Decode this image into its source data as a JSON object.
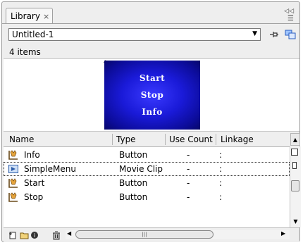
{
  "tab": {
    "label": "Library",
    "close": "×"
  },
  "panel_menu": {
    "collapse": "◁◁",
    "options": "☰"
  },
  "document_select": {
    "value": "Untitled-1"
  },
  "item_count": "4 items",
  "preview": {
    "buttons": [
      "Start",
      "Stop",
      "Info"
    ]
  },
  "columns": {
    "name": "Name",
    "type": "Type",
    "use_count": "Use Count",
    "linkage": "Linkage"
  },
  "items": [
    {
      "name": "Info",
      "type": "Button",
      "use_count": "-",
      "linkage": ":",
      "icon": "button-symbol-icon"
    },
    {
      "name": "SimpleMenu",
      "type": "Movie Clip",
      "use_count": "-",
      "linkage": ":",
      "icon": "movie-clip-symbol-icon",
      "selected": true
    },
    {
      "name": "Start",
      "type": "Button",
      "use_count": "-",
      "linkage": ":",
      "icon": "button-symbol-icon"
    },
    {
      "name": "Stop",
      "type": "Button",
      "use_count": "-",
      "linkage": ":",
      "icon": "button-symbol-icon"
    }
  ],
  "colors": {
    "preview_bg": "#1a1ad8",
    "panel_bg": "#eeeeee"
  }
}
